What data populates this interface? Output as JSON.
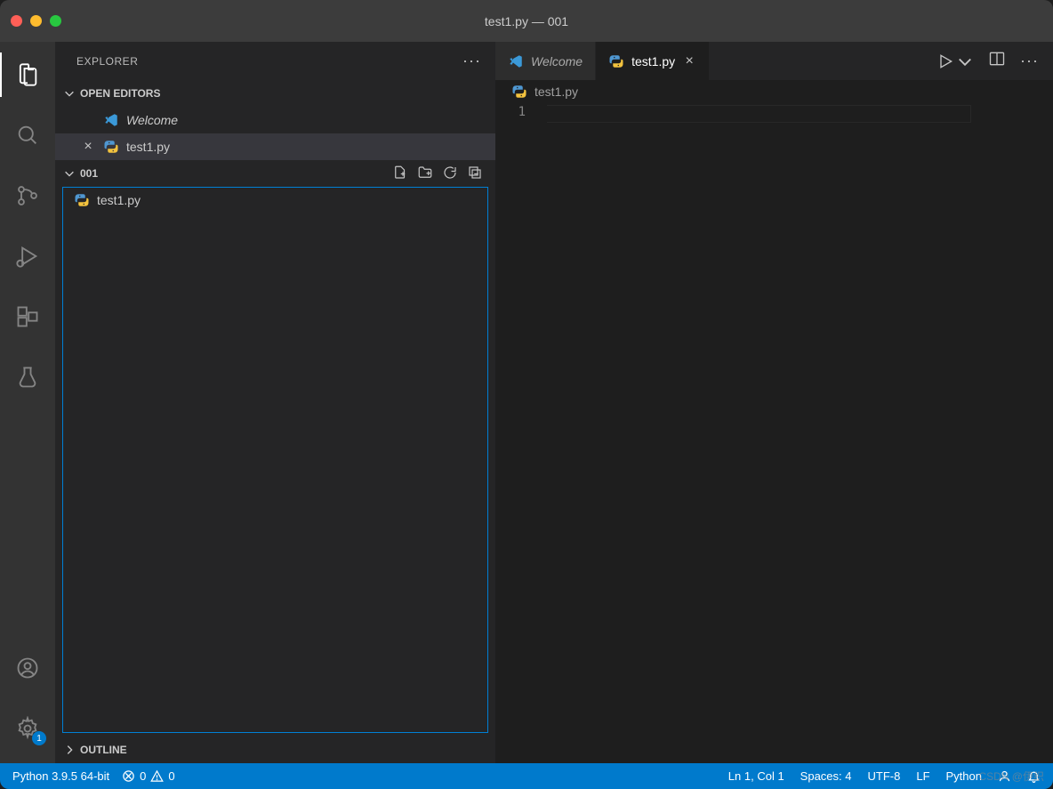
{
  "window": {
    "title": "test1.py — 001"
  },
  "sidebar": {
    "title": "EXPLORER",
    "open_editors_label": "OPEN EDITORS",
    "editors": [
      {
        "label": "Welcome",
        "icon": "vscode",
        "italic": true,
        "close": false
      },
      {
        "label": "test1.py",
        "icon": "python",
        "italic": false,
        "close": true,
        "active": true
      }
    ],
    "folder_name": "001",
    "files": [
      {
        "label": "test1.py",
        "icon": "python"
      }
    ],
    "outline_label": "OUTLINE"
  },
  "tabs": [
    {
      "label": "Welcome",
      "icon": "vscode",
      "italic": true,
      "active": false
    },
    {
      "label": "test1.py",
      "icon": "python",
      "italic": false,
      "active": true,
      "closeable": true
    }
  ],
  "breadcrumb": {
    "file": "test1.py",
    "icon": "python"
  },
  "editor": {
    "line_numbers": [
      "1"
    ]
  },
  "status": {
    "python": "Python 3.9.5 64-bit",
    "errors": "0",
    "warnings": "0",
    "position": "Ln 1, Col 1",
    "spaces": "Spaces: 4",
    "encoding": "UTF-8",
    "eol": "LF",
    "language": "Python"
  },
  "activity": {
    "settings_badge": "1"
  },
  "watermark": "CSDN @伊织"
}
